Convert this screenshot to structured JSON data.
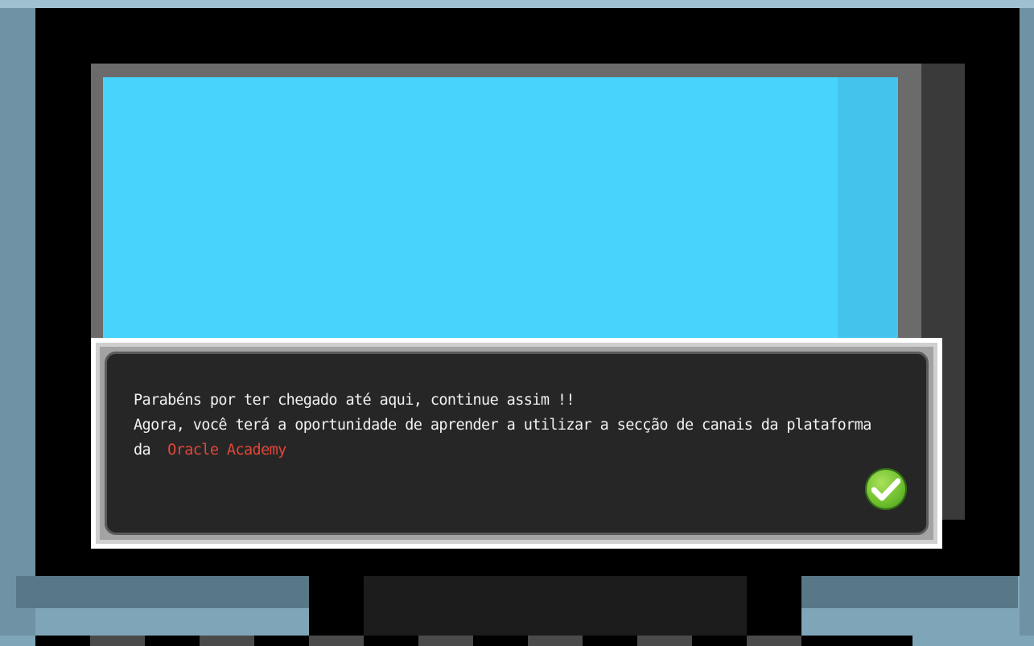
{
  "dialog": {
    "line1": "Parabéns por ter chegado até aqui, continue assim !!",
    "line2": "Agora, você terá a oportunidade de aprender a utilizar a secção de canais da plataforma",
    "line3_prefix": "da",
    "line3_highlight": "Oracle Academy"
  },
  "icons": {
    "confirm": "check-icon"
  },
  "colors": {
    "screen": "#48d3fd",
    "dialog_background": "#262626",
    "dialog_text": "#f2f2f2",
    "highlight_text": "#e0473a",
    "confirm_button": "#6fbf2e"
  }
}
